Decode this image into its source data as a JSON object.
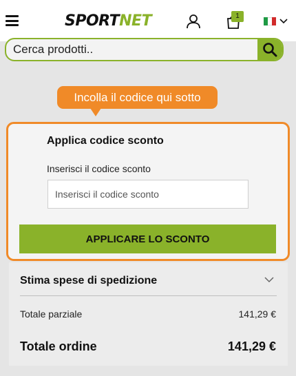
{
  "header": {
    "logo_part1": "SPORT",
    "logo_part2": "NET",
    "cart_count": "1",
    "icons": [
      "menu-icon",
      "user-icon",
      "cart-icon",
      "flag-italy-icon",
      "chevron-down-icon"
    ]
  },
  "search": {
    "placeholder": "Cerca prodotti..",
    "button_icon": "search-icon"
  },
  "tooltip": {
    "text": "Incolla il codice qui sotto"
  },
  "coupon": {
    "title": "Applica codice sconto",
    "label": "Inserisci il codice sconto",
    "placeholder": "Inserisci il codice sconto",
    "apply_label": "APPLICARE LO SCONTO"
  },
  "summary": {
    "shipping_label": "Stima spese di spedizione",
    "subtotal_label": "Totale parziale",
    "subtotal_value": "141,29 €",
    "total_label": "Totale ordine",
    "total_value": "141,29 €"
  },
  "colors": {
    "accent_green": "#8ab22a",
    "accent_orange": "#f08a28",
    "background": "#e5e5e5"
  }
}
